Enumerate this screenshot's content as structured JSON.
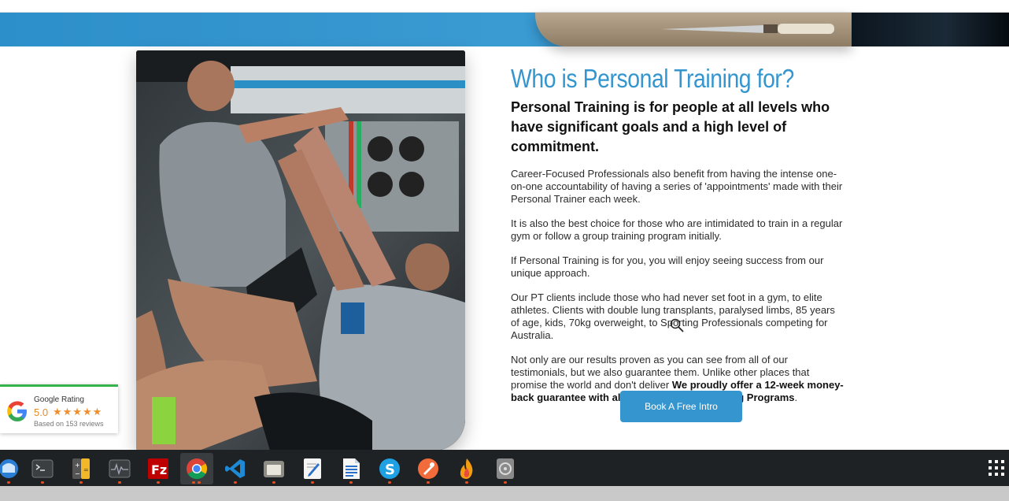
{
  "colors": {
    "accent": "#3596cf",
    "banner": "#3a9ad2",
    "rating_accent": "#36b34a",
    "star": "#f08e2c",
    "taskbar": "#1f2224"
  },
  "section": {
    "heading": "Who is Personal Training for?",
    "subheading": "Personal Training is for people at all levels who have significant goals and a high level of commitment.",
    "paragraphs": [
      "Career-Focused Professionals also benefit from having the intense one-on-one accountability of having a series of 'appointments' made with their Personal Trainer each week.",
      "It is also the best choice for those who are intimidated to train in a regular gym or follow a group training program initially.",
      "If Personal Training is for you, you will enjoy seeing success from our unique approach.",
      "Our PT clients include those who had never set foot in a gym, to elite athletes. Clients with double lung transplants, paralysed limbs, 85 years of age, kids, 70kg overweight, to Sporting Professionals competing for Australia."
    ],
    "last_paragraph_plain": "Not only are our results proven as you can see from all of our testimonials, but we also guarantee them. Unlike other places that promise the world and don't deliver ",
    "last_paragraph_bold": "We proudly offer a 12-week money-back guarantee with all of our Personal Training Programs",
    "last_paragraph_end": ".",
    "cta_label": "Book A Free Intro",
    "photo_icon": "trainer-high-five-photo"
  },
  "rating_widget": {
    "title": "Google Rating",
    "score": "5.0",
    "stars": "★★★★★",
    "reviews": "Based on 153 reviews",
    "logo_icon": "google-g-icon"
  },
  "taskbar": {
    "apps": [
      {
        "name": "thunderbird",
        "icon": "mail-client-icon"
      },
      {
        "name": "terminal",
        "icon": "terminal-icon"
      },
      {
        "name": "calculator",
        "icon": "calculator-icon"
      },
      {
        "name": "system-monitor",
        "icon": "activity-monitor-icon"
      },
      {
        "name": "filezilla",
        "icon": "filezilla-icon"
      },
      {
        "name": "chrome",
        "icon": "chrome-icon"
      },
      {
        "name": "vscode",
        "icon": "vscode-icon"
      },
      {
        "name": "files",
        "icon": "file-manager-icon"
      },
      {
        "name": "text-editor",
        "icon": "text-editor-icon"
      },
      {
        "name": "writer",
        "icon": "document-writer-icon"
      },
      {
        "name": "skype",
        "icon": "skype-icon"
      },
      {
        "name": "postman",
        "icon": "postman-icon"
      },
      {
        "name": "flame",
        "icon": "flame-app-icon"
      },
      {
        "name": "disk-utility",
        "icon": "disk-icon"
      }
    ],
    "show_apps_icon": "app-grid-icon"
  }
}
